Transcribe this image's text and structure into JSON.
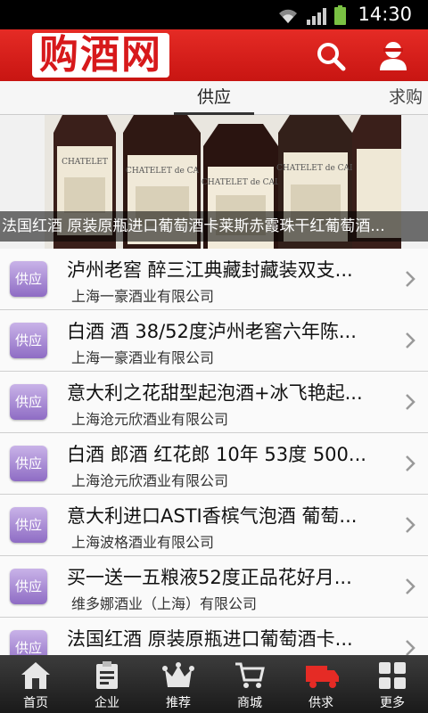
{
  "status": {
    "time": "14:30"
  },
  "header": {
    "logo_text": "购酒网"
  },
  "tabs": [
    {
      "label": "供应"
    },
    {
      "label": "求购"
    }
  ],
  "banner": {
    "caption": "法国红酒 原装原瓶进口葡萄酒卡莱斯赤霞珠干红葡萄酒..."
  },
  "items": [
    {
      "badge": "供应",
      "title": "泸州老窖 醉三江典藏封藏装双支...",
      "company": "上海一豪酒业有限公司"
    },
    {
      "badge": "供应",
      "title": "白酒 酒 38/52度泸州老窖六年陈...",
      "company": "上海一豪酒业有限公司"
    },
    {
      "badge": "供应",
      "title": "意大利之花甜型起泡酒+冰飞艳起...",
      "company": "上海沧元欣酒业有限公司"
    },
    {
      "badge": "供应",
      "title": "白酒 郎酒 红花郎 10年 53度 500...",
      "company": "上海沧元欣酒业有限公司"
    },
    {
      "badge": "供应",
      "title": "意大利进口ASTI香槟气泡酒 葡萄...",
      "company": "上海波格酒业有限公司"
    },
    {
      "badge": "供应",
      "title": "买一送一五粮液52度正品花好月...",
      "company": "维多娜酒业（上海）有限公司"
    },
    {
      "badge": "供应",
      "title": "法国红酒 原装原瓶进口葡萄酒卡...",
      "company": ""
    }
  ],
  "nav": [
    {
      "label": "首页",
      "icon": "home-icon"
    },
    {
      "label": "企业",
      "icon": "company-icon"
    },
    {
      "label": "推荐",
      "icon": "crown-icon"
    },
    {
      "label": "商城",
      "icon": "cart-icon"
    },
    {
      "label": "供求",
      "icon": "truck-icon"
    },
    {
      "label": "更多",
      "icon": "grid-icon"
    }
  ],
  "colors": {
    "header_red": "#d7191b",
    "badge_purple": "#8e6cc4",
    "nav_active_red": "#e52b25"
  }
}
